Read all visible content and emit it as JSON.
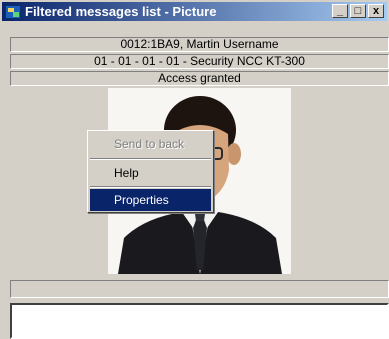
{
  "window": {
    "title": "Filtered messages list - Picture",
    "controls": {
      "minimize": "_",
      "maximize": "□",
      "close": "x"
    }
  },
  "info": {
    "user": "0012:1BA9, Martin Username",
    "device": "01 - 01 - 01 - 01 - Security NCC KT-300",
    "status": "Access granted"
  },
  "context_menu": {
    "items": [
      {
        "label": "Send to back",
        "state": "disabled"
      },
      {
        "label": "Help",
        "state": "normal"
      },
      {
        "label": "Properties",
        "state": "selected"
      }
    ]
  },
  "colors": {
    "titlebar_start": "#0a246a",
    "titlebar_end": "#a6caf0",
    "face": "#d4d0c8",
    "menu_highlight": "#0a246a"
  }
}
